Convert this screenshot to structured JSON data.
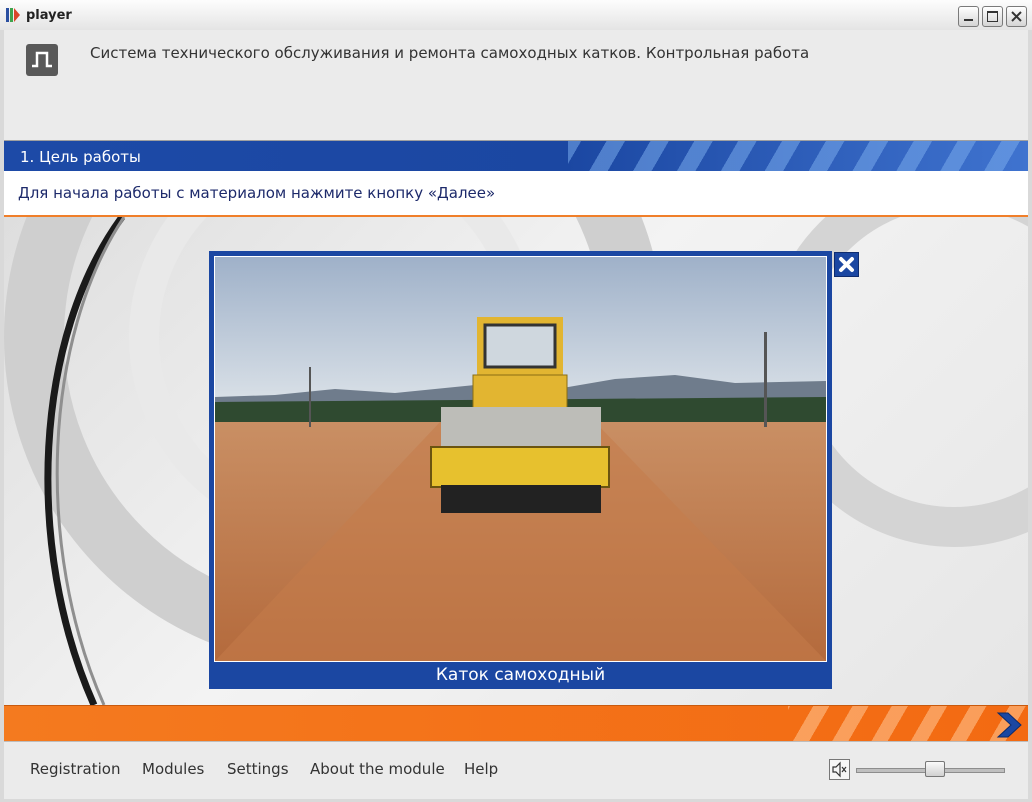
{
  "window": {
    "title": "player"
  },
  "header": {
    "course_title": "Система технического обслуживания и ремонта самоходных катков. Контрольная работа"
  },
  "section": {
    "title": "1. Цель работы"
  },
  "instruction": "Для начала работы с материалом нажмите кнопку «Далее»",
  "popup": {
    "caption": "Каток самоходный"
  },
  "footer": {
    "nav": [
      "Registration",
      "Modules",
      "Settings",
      "About the module",
      "Help"
    ],
    "volume_level": 0.5
  },
  "colors": {
    "accent_blue": "#1b47a2",
    "accent_orange": "#f47a1f",
    "text_dark_blue": "#1d2a6b"
  },
  "icons": {
    "app": "player-logo-icon",
    "close_popup": "close-icon",
    "next": "chevron-right-icon",
    "sound": "speaker-icon"
  }
}
